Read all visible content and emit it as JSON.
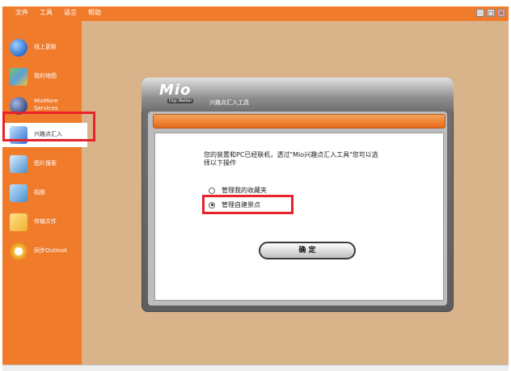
{
  "menu": [
    "文件",
    "工具",
    "语言",
    "帮助"
  ],
  "window_controls": [
    "_",
    "□",
    "✕"
  ],
  "sidebar": {
    "items": [
      {
        "label": "线上更新",
        "icon": "globe-icon",
        "color": "#2d6fd1"
      },
      {
        "label": "我的地图",
        "icon": "map-icon",
        "color": "#5aa0d6"
      },
      {
        "label": "MioMore Services",
        "label_lines": [
          "MioMore",
          "Services"
        ],
        "icon": "services-globe-icon",
        "color": "#3a4f8a"
      },
      {
        "label": "兴趣点汇入",
        "icon": "poi-import-icon",
        "color": "#2d6fd1",
        "active": true
      },
      {
        "label": "图片搜索",
        "icon": "photo-search-icon",
        "color": "#4a90c8"
      },
      {
        "label": "相册",
        "icon": "album-icon",
        "color": "#4a90c8"
      },
      {
        "label": "传输文件",
        "icon": "folder-icon",
        "color": "#f0b030"
      },
      {
        "label": "同步Outlook",
        "icon": "outlook-sync-icon",
        "color": "#f5c040"
      }
    ]
  },
  "dialog": {
    "logo": "Mio",
    "brand_badge": "Digi Walker",
    "title": "兴趣点汇入工具",
    "description": "您的装置和PC已经联机，透过\"Mio兴趣点汇入工具\"您可以选择以下操作",
    "options": [
      {
        "label": "管理我的收藏夹",
        "selected": false
      },
      {
        "label": "管理自建景点",
        "selected": true
      }
    ],
    "ok_label": "确 定"
  },
  "colors": {
    "accent": "#ef7b2b",
    "highlight": "#e8222a",
    "background": "#d9b48a"
  }
}
